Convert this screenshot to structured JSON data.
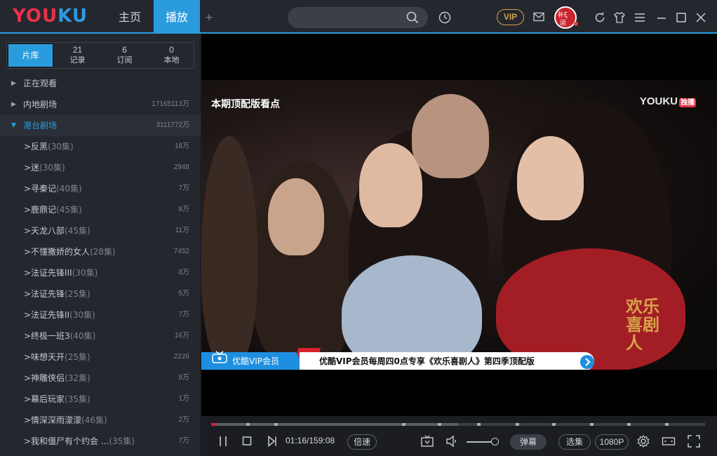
{
  "app": {
    "logo_part1": "YOU",
    "logo_part2": "KU",
    "tabs": [
      {
        "label": "主页",
        "active": false
      },
      {
        "label": "播放",
        "active": true
      }
    ],
    "add_tab": "+",
    "vip_label": "VIP",
    "colors": {
      "accent": "#2a9cde",
      "brand_red": "#e8324b",
      "vip_gold": "#d3a24c"
    }
  },
  "sidebar": {
    "tabs": [
      {
        "count": "",
        "label": "片库",
        "active": true
      },
      {
        "count": "21",
        "label": "记录"
      },
      {
        "count": "6",
        "label": "订阅"
      },
      {
        "count": "0",
        "label": "本地"
      }
    ],
    "categories": [
      {
        "name": "正在观看",
        "count": "",
        "expanded": false
      },
      {
        "name": "内地剧场",
        "count": "17165113万",
        "expanded": false
      },
      {
        "name": "港台剧场",
        "count": "3111772万",
        "expanded": true
      }
    ],
    "items": [
      {
        "name": ">反黑",
        "episodes": "(30集)",
        "count": "18万"
      },
      {
        "name": ">迷",
        "episodes": "(30集)",
        "count": "2948"
      },
      {
        "name": ">寻秦记",
        "episodes": "(40集)",
        "count": "7万"
      },
      {
        "name": ">鹿鼎记",
        "episodes": "(45集)",
        "count": "8万"
      },
      {
        "name": ">天龙八部",
        "episodes": "(45集)",
        "count": "11万"
      },
      {
        "name": ">不懂撒娇的女人",
        "episodes": "(28集)",
        "count": "7452"
      },
      {
        "name": ">法证先锋III",
        "episodes": "(30集)",
        "count": "8万"
      },
      {
        "name": ">法证先锋",
        "episodes": "(25集)",
        "count": "5万"
      },
      {
        "name": ">法证先锋II",
        "episodes": "(30集)",
        "count": "7万"
      },
      {
        "name": ">终极一班3",
        "episodes": "(40集)",
        "count": "16万"
      },
      {
        "name": ">味想天开",
        "episodes": "(25集)",
        "count": "2226"
      },
      {
        "name": ">神雕侠侣",
        "episodes": "(32集)",
        "count": "8万"
      },
      {
        "name": ">幕后玩家",
        "episodes": "(35集)",
        "count": "1万"
      },
      {
        "name": ">情深深雨濛濛",
        "episodes": "(46集)",
        "count": "2万"
      },
      {
        "name": ">我和僵尸有个约会 ...",
        "episodes": "(35集)",
        "count": "7万"
      }
    ]
  },
  "player": {
    "video_title": "本期顶配版看点",
    "video_logo": "YOUKU",
    "video_logo_tag": "独播",
    "show_logo": "欢乐喜剧人",
    "banner_left": "优酷VIP会员",
    "banner_right": "优酷VIP会员每周四0点专享《欢乐喜剧人》第四季顶配版",
    "time": "01:16/159:08",
    "progress": 0.008,
    "buffered": 0.5,
    "speed_label": "倍速",
    "danmaku_label": "弹幕",
    "episodes_label": "选集",
    "quality_label": "1080P",
    "volume": 0.9
  }
}
